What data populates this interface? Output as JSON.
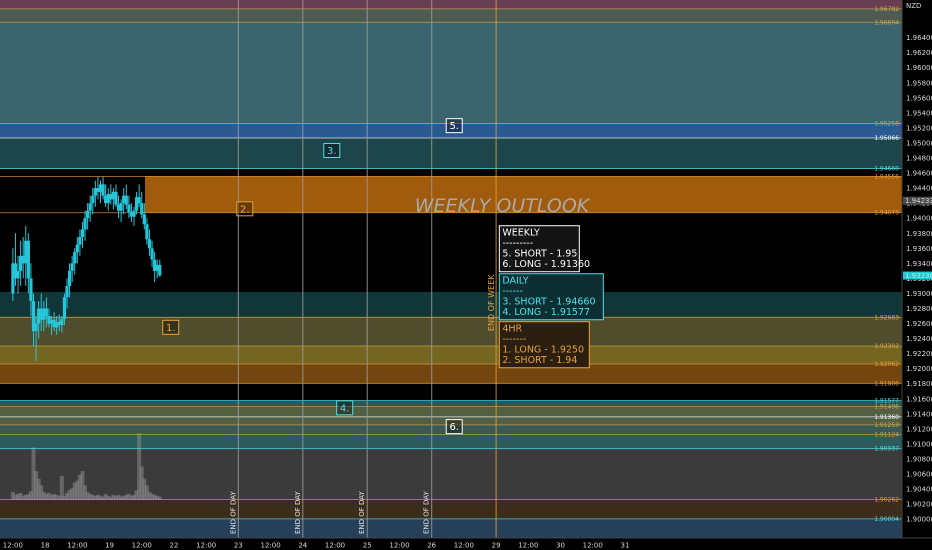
{
  "chart_data": {
    "type": "candlestick",
    "title": "WEEKLY OUTLOOK",
    "currency": "NZD",
    "ylim": [
      1.8975,
      1.969
    ],
    "xlim": [
      -0.2,
      13.8
    ],
    "y_ticks": [
      1.964,
      1.962,
      1.96,
      1.958,
      1.956,
      1.954,
      1.952,
      1.95,
      1.948,
      1.946,
      1.944,
      1.942,
      1.94,
      1.938,
      1.936,
      1.934,
      1.932,
      1.93,
      1.928,
      1.926,
      1.924,
      1.922,
      1.92,
      1.918,
      1.916,
      1.914,
      1.912,
      1.91,
      1.908,
      1.906,
      1.904,
      1.902,
      1.9
    ],
    "y_tick_labels": [
      "1.96400",
      "1.96200",
      "1.96000",
      "1.95800",
      "1.95600",
      "1.95400",
      "1.95200",
      "1.95000",
      "1.94800",
      "1.94600",
      "1.94400",
      "1.94200",
      "1.94000",
      "1.93800",
      "1.93600",
      "1.93400",
      "1.93200",
      "1.93000",
      "1.92800",
      "1.92600",
      "1.92400",
      "1.92200",
      "1.92000",
      "1.91800",
      "1.91600",
      "1.91400",
      "1.91200",
      "1.91000",
      "1.90800",
      "1.90600",
      "1.90400",
      "1.90200",
      "1.90000"
    ],
    "x_ticks": [
      {
        "x": 0.0,
        "label": "12:00"
      },
      {
        "x": 0.5,
        "label": "18"
      },
      {
        "x": 1.0,
        "label": "12:00"
      },
      {
        "x": 1.5,
        "label": "19"
      },
      {
        "x": 2.0,
        "label": "12:00"
      },
      {
        "x": 2.5,
        "label": "22"
      },
      {
        "x": 3.0,
        "label": "12:00"
      },
      {
        "x": 3.5,
        "label": "23"
      },
      {
        "x": 4.0,
        "label": "12:00"
      },
      {
        "x": 4.5,
        "label": "24"
      },
      {
        "x": 5.0,
        "label": "12:00"
      },
      {
        "x": 5.5,
        "label": "25"
      },
      {
        "x": 6.0,
        "label": "12:00"
      },
      {
        "x": 6.5,
        "label": "26"
      },
      {
        "x": 7.0,
        "label": "12:00"
      },
      {
        "x": 7.5,
        "label": "29"
      },
      {
        "x": 8.0,
        "label": "12:00"
      },
      {
        "x": 8.5,
        "label": "30"
      },
      {
        "x": 9.0,
        "label": "12:00"
      },
      {
        "x": 9.5,
        "label": "31"
      }
    ],
    "day_separators": [
      3.5,
      4.5,
      5.5,
      6.5
    ],
    "day_separator_label": "END OF DAY",
    "week_separator": 7.5,
    "week_separator_label": "END OF WEEK",
    "current_price": {
      "label": "1.94233",
      "value": 1.94233
    },
    "last_close": {
      "label": "1.93238",
      "value": 1.93238
    },
    "levels": [
      {
        "value": 1.96782,
        "label": "1.96782",
        "color": "#d4a84b"
      },
      {
        "value": 1.96604,
        "label": "1.96604",
        "color": "#d4a84b"
      },
      {
        "value": 1.95258,
        "label": "1.95258",
        "color": "#d4a84b"
      },
      {
        "value": 1.95066,
        "label": "1.95066",
        "color": "#ffffff"
      },
      {
        "value": 1.9466,
        "label": "1.94660",
        "color": "#4ee0e8"
      },
      {
        "value": 1.94556,
        "label": "1.94556",
        "color": "#e8a23c"
      },
      {
        "value": 1.94073,
        "label": "1.94073",
        "color": "#e8a23c"
      },
      {
        "value": 1.92683,
        "label": "1.92683",
        "color": "#d4a84b"
      },
      {
        "value": 1.92302,
        "label": "1.92302",
        "color": "#d4a84b"
      },
      {
        "value": 1.92062,
        "label": "1.92062",
        "color": "#e8a23c"
      },
      {
        "value": 1.91806,
        "label": "1.91806",
        "color": "#e8a23c"
      },
      {
        "value": 1.91577,
        "label": "1.91577",
        "color": "#4ee0e8"
      },
      {
        "value": 1.91496,
        "label": "1.91496",
        "color": "#d4a84b"
      },
      {
        "value": 1.9136,
        "label": "1.91360",
        "color": "#ffffff"
      },
      {
        "value": 1.91253,
        "label": "1.91253",
        "color": "#d4a84b"
      },
      {
        "value": 1.91124,
        "label": "1.91124",
        "color": "#d4a84b"
      },
      {
        "value": 1.90937,
        "label": "1.90937",
        "color": "#4ee0e8"
      },
      {
        "value": 1.90262,
        "label": "1.90262",
        "color": "#e8a23c"
      },
      {
        "value": 1.90004,
        "label": "1.90004",
        "color": "#4ee0e8"
      }
    ],
    "zones": [
      {
        "id": "z1",
        "from": 1.96782,
        "to": 1.969,
        "color": "#7a4a60",
        "opacity": 0.85
      },
      {
        "id": "z2",
        "from": 1.96604,
        "to": 1.96782,
        "color": "#5b6b62",
        "opacity": 0.85
      },
      {
        "id": "z3",
        "from": 1.95258,
        "to": 1.96604,
        "color": "#3e6a74",
        "opacity": 0.95
      },
      {
        "id": "z4",
        "from": 1.95066,
        "to": 1.95258,
        "color": "#2c5f98",
        "opacity": 0.95
      },
      {
        "id": "z5",
        "from": 1.9466,
        "to": 1.95066,
        "color": "#1e4a4e",
        "opacity": 0.95
      },
      {
        "id": "z6",
        "from": 1.94073,
        "to": 1.94556,
        "color": "#a9600e",
        "opacity": 0.95,
        "x_from": 2.05
      },
      {
        "id": "z7",
        "from": 1.92683,
        "to": 1.9302,
        "color": "#12393b",
        "opacity": 0.95
      },
      {
        "id": "z8",
        "from": 1.92302,
        "to": 1.92683,
        "color": "#54512e",
        "opacity": 0.95
      },
      {
        "id": "z9",
        "from": 1.92062,
        "to": 1.92302,
        "color": "#7a6a22",
        "opacity": 0.95
      },
      {
        "id": "z10",
        "from": 1.91806,
        "to": 1.92062,
        "color": "#7a4a10",
        "opacity": 0.95
      },
      {
        "id": "z11",
        "from": 1.91496,
        "to": 1.91577,
        "color": "#2f5c56",
        "opacity": 0.95
      },
      {
        "id": "z12",
        "from": 1.91253,
        "to": 1.91496,
        "color": "#576446",
        "opacity": 0.95
      },
      {
        "id": "z13",
        "from": 1.91124,
        "to": 1.91253,
        "color": "#3e5e58",
        "opacity": 0.95
      },
      {
        "id": "z14",
        "from": 1.90937,
        "to": 1.91124,
        "color": "#2f5f60",
        "opacity": 0.95
      },
      {
        "id": "z15",
        "from": 1.90262,
        "to": 1.90937,
        "color": "#3b3b3b",
        "opacity": 1.0
      },
      {
        "id": "z16",
        "from": 1.90004,
        "to": 1.90262,
        "color": "#3c2c1c",
        "opacity": 1.0
      },
      {
        "id": "z17",
        "from": 1.8975,
        "to": 1.90004,
        "color": "#26405a",
        "opacity": 1.0
      }
    ],
    "zone_markers": [
      {
        "label": "1.",
        "x": 2.45,
        "y": 1.9255,
        "color": "#e8a23c"
      },
      {
        "label": "2.",
        "x": 3.6,
        "y": 1.94125,
        "color": "#e8a23c"
      },
      {
        "label": "3.",
        "x": 4.95,
        "y": 1.949,
        "color": "#4ee0e8"
      },
      {
        "label": "4.",
        "x": 5.15,
        "y": 1.9148,
        "color": "#4ee0e8"
      },
      {
        "label": "5.",
        "x": 6.85,
        "y": 1.9523,
        "color": "#ffffff"
      },
      {
        "label": "6.",
        "x": 6.85,
        "y": 1.9123,
        "color": "#ffffff"
      }
    ],
    "summary_boxes": [
      {
        "title": "WEEKLY",
        "lines": [
          "---------",
          "5. SHORT - 1.95",
          "6. LONG - 1.91360"
        ],
        "color": "#ffffff",
        "bg": "#141414"
      },
      {
        "title": "DAILY",
        "lines": [
          "------",
          "3. SHORT - 1.94660",
          "4. LONG - 1.91577"
        ],
        "color": "#4ee0e8",
        "bg": "#0d2f33"
      },
      {
        "title": "4HR",
        "lines": [
          "-------",
          "1. LONG - 1.9250",
          "2. SHORT - 1.94"
        ],
        "color": "#e8a23c",
        "bg": "#2b1f12"
      }
    ],
    "ohlc": [
      {
        "x": 0.0,
        "o": 1.93,
        "h": 1.936,
        "l": 1.929,
        "c": 1.934
      },
      {
        "x": 0.04,
        "o": 1.934,
        "h": 1.938,
        "l": 1.931,
        "c": 1.932
      },
      {
        "x": 0.08,
        "o": 1.932,
        "h": 1.935,
        "l": 1.93,
        "c": 1.933
      },
      {
        "x": 0.12,
        "o": 1.933,
        "h": 1.937,
        "l": 1.931,
        "c": 1.935
      },
      {
        "x": 0.16,
        "o": 1.935,
        "h": 1.9375,
        "l": 1.932,
        "c": 1.934
      },
      {
        "x": 0.2,
        "o": 1.934,
        "h": 1.939,
        "l": 1.931,
        "c": 1.937
      },
      {
        "x": 0.24,
        "o": 1.937,
        "h": 1.938,
        "l": 1.93,
        "c": 1.932
      },
      {
        "x": 0.28,
        "o": 1.932,
        "h": 1.934,
        "l": 1.927,
        "c": 1.929
      },
      {
        "x": 0.32,
        "o": 1.929,
        "h": 1.93,
        "l": 1.923,
        "c": 1.925
      },
      {
        "x": 0.36,
        "o": 1.925,
        "h": 1.927,
        "l": 1.921,
        "c": 1.926
      },
      {
        "x": 0.4,
        "o": 1.926,
        "h": 1.929,
        "l": 1.924,
        "c": 1.928
      },
      {
        "x": 0.44,
        "o": 1.928,
        "h": 1.93,
        "l": 1.925,
        "c": 1.9265
      },
      {
        "x": 0.48,
        "o": 1.9265,
        "h": 1.929,
        "l": 1.925,
        "c": 1.928
      },
      {
        "x": 0.52,
        "o": 1.928,
        "h": 1.9295,
        "l": 1.9255,
        "c": 1.927
      },
      {
        "x": 0.56,
        "o": 1.927,
        "h": 1.928,
        "l": 1.9255,
        "c": 1.926
      },
      {
        "x": 0.6,
        "o": 1.926,
        "h": 1.927,
        "l": 1.9245,
        "c": 1.9265
      },
      {
        "x": 0.64,
        "o": 1.9265,
        "h": 1.9275,
        "l": 1.925,
        "c": 1.9255
      },
      {
        "x": 0.68,
        "o": 1.9255,
        "h": 1.927,
        "l": 1.9245,
        "c": 1.9262
      },
      {
        "x": 0.72,
        "o": 1.9262,
        "h": 1.9272,
        "l": 1.925,
        "c": 1.9258
      },
      {
        "x": 0.76,
        "o": 1.9258,
        "h": 1.927,
        "l": 1.9248,
        "c": 1.9266
      },
      {
        "x": 0.8,
        "o": 1.9266,
        "h": 1.93,
        "l": 1.9258,
        "c": 1.9295
      },
      {
        "x": 0.84,
        "o": 1.9295,
        "h": 1.932,
        "l": 1.928,
        "c": 1.931
      },
      {
        "x": 0.88,
        "o": 1.931,
        "h": 1.934,
        "l": 1.9295,
        "c": 1.933
      },
      {
        "x": 0.92,
        "o": 1.933,
        "h": 1.935,
        "l": 1.9315,
        "c": 1.934
      },
      {
        "x": 0.96,
        "o": 1.934,
        "h": 1.936,
        "l": 1.9325,
        "c": 1.9355
      },
      {
        "x": 1.0,
        "o": 1.9355,
        "h": 1.9375,
        "l": 1.934,
        "c": 1.9365
      },
      {
        "x": 1.04,
        "o": 1.9365,
        "h": 1.9385,
        "l": 1.935,
        "c": 1.9375
      },
      {
        "x": 1.08,
        "o": 1.9375,
        "h": 1.9395,
        "l": 1.936,
        "c": 1.9385
      },
      {
        "x": 1.12,
        "o": 1.9385,
        "h": 1.941,
        "l": 1.937,
        "c": 1.94
      },
      {
        "x": 1.16,
        "o": 1.94,
        "h": 1.942,
        "l": 1.9385,
        "c": 1.941
      },
      {
        "x": 1.2,
        "o": 1.941,
        "h": 1.943,
        "l": 1.9395,
        "c": 1.942
      },
      {
        "x": 1.24,
        "o": 1.942,
        "h": 1.944,
        "l": 1.9405,
        "c": 1.943
      },
      {
        "x": 1.28,
        "o": 1.943,
        "h": 1.945,
        "l": 1.9415,
        "c": 1.944
      },
      {
        "x": 1.32,
        "o": 1.944,
        "h": 1.9455,
        "l": 1.9425,
        "c": 1.9435
      },
      {
        "x": 1.36,
        "o": 1.9435,
        "h": 1.945,
        "l": 1.942,
        "c": 1.9445
      },
      {
        "x": 1.4,
        "o": 1.9445,
        "h": 1.9455,
        "l": 1.9425,
        "c": 1.943
      },
      {
        "x": 1.44,
        "o": 1.943,
        "h": 1.9445,
        "l": 1.9415,
        "c": 1.942
      },
      {
        "x": 1.48,
        "o": 1.942,
        "h": 1.944,
        "l": 1.941,
        "c": 1.9432
      },
      {
        "x": 1.52,
        "o": 1.9432,
        "h": 1.9445,
        "l": 1.9418,
        "c": 1.9425
      },
      {
        "x": 1.56,
        "o": 1.9425,
        "h": 1.944,
        "l": 1.9412,
        "c": 1.9435
      },
      {
        "x": 1.6,
        "o": 1.9435,
        "h": 1.9445,
        "l": 1.9415,
        "c": 1.9418
      },
      {
        "x": 1.64,
        "o": 1.9418,
        "h": 1.943,
        "l": 1.94,
        "c": 1.941
      },
      {
        "x": 1.68,
        "o": 1.941,
        "h": 1.9425,
        "l": 1.9395,
        "c": 1.942
      },
      {
        "x": 1.72,
        "o": 1.942,
        "h": 1.944,
        "l": 1.9405,
        "c": 1.943
      },
      {
        "x": 1.76,
        "o": 1.943,
        "h": 1.9445,
        "l": 1.9412,
        "c": 1.9418
      },
      {
        "x": 1.8,
        "o": 1.9418,
        "h": 1.943,
        "l": 1.94,
        "c": 1.9408
      },
      {
        "x": 1.84,
        "o": 1.9408,
        "h": 1.942,
        "l": 1.9395,
        "c": 1.9402
      },
      {
        "x": 1.88,
        "o": 1.9402,
        "h": 1.9415,
        "l": 1.939,
        "c": 1.941
      },
      {
        "x": 1.92,
        "o": 1.941,
        "h": 1.9435,
        "l": 1.9405,
        "c": 1.9428
      },
      {
        "x": 1.96,
        "o": 1.9428,
        "h": 1.9445,
        "l": 1.9415,
        "c": 1.942
      },
      {
        "x": 2.0,
        "o": 1.942,
        "h": 1.9435,
        "l": 1.94,
        "c": 1.9405
      },
      {
        "x": 2.04,
        "o": 1.9405,
        "h": 1.942,
        "l": 1.9385,
        "c": 1.9392
      },
      {
        "x": 2.08,
        "o": 1.9392,
        "h": 1.94,
        "l": 1.9365,
        "c": 1.9372
      },
      {
        "x": 2.12,
        "o": 1.9372,
        "h": 1.9385,
        "l": 1.935,
        "c": 1.936
      },
      {
        "x": 2.16,
        "o": 1.936,
        "h": 1.937,
        "l": 1.9335,
        "c": 1.9345
      },
      {
        "x": 2.2,
        "o": 1.9345,
        "h": 1.9355,
        "l": 1.9315,
        "c": 1.933
      },
      {
        "x": 2.24,
        "o": 1.933,
        "h": 1.9345,
        "l": 1.932,
        "c": 1.9338
      },
      {
        "x": 2.28,
        "o": 1.9338,
        "h": 1.9345,
        "l": 1.9322,
        "c": 1.9324
      }
    ],
    "volume": [
      0.08,
      0.05,
      0.06,
      0.07,
      0.04,
      0.05,
      0.06,
      0.09,
      0.55,
      0.3,
      0.22,
      0.15,
      0.08,
      0.06,
      0.07,
      0.05,
      0.06,
      0.05,
      0.04,
      0.25,
      0.04,
      0.07,
      0.1,
      0.12,
      0.18,
      0.2,
      0.26,
      0.3,
      0.15,
      0.08,
      0.06,
      0.05,
      0.04,
      0.05,
      0.04,
      0.03,
      0.06,
      0.04,
      0.03,
      0.05,
      0.04,
      0.05,
      0.03,
      0.04,
      0.05,
      0.06,
      0.04,
      0.05,
      0.1,
      0.7,
      0.35,
      0.22,
      0.15,
      0.08,
      0.06,
      0.05,
      0.04,
      0.03
    ]
  }
}
